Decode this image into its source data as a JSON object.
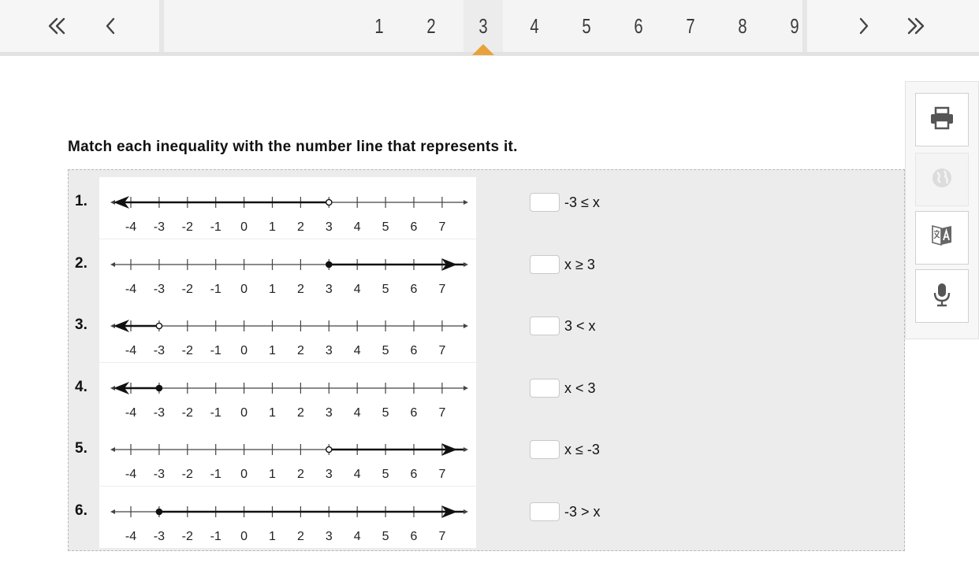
{
  "nav": {
    "first_icon": "double-chevron-left-icon",
    "prev_icon": "chevron-left-icon",
    "next_icon": "chevron-right-icon",
    "last_icon": "double-chevron-right-icon",
    "pages": [
      "1",
      "2",
      "3",
      "4",
      "5",
      "6",
      "7",
      "8",
      "9"
    ],
    "current_page": "3",
    "accent_color": "#e8a23c"
  },
  "instruction": "Match each inequality with the number line that represents it.",
  "number_line": {
    "ticks": [
      -4,
      -3,
      -2,
      -1,
      0,
      1,
      2,
      3,
      4,
      5,
      6,
      7
    ],
    "tick_labels": [
      "-4",
      "-3",
      "-2",
      "-1",
      "0",
      "1",
      "2",
      "3",
      "4",
      "5",
      "6",
      "7"
    ]
  },
  "rows": [
    {
      "number": "1.",
      "graph": {
        "point": 3,
        "closed": false,
        "direction": "left"
      },
      "answer_label": "-3 ≤ x"
    },
    {
      "number": "2.",
      "graph": {
        "point": 3,
        "closed": true,
        "direction": "right"
      },
      "answer_label": "x ≥ 3"
    },
    {
      "number": "3.",
      "graph": {
        "point": -3,
        "closed": false,
        "direction": "left"
      },
      "answer_label": "3 < x"
    },
    {
      "number": "4.",
      "graph": {
        "point": -3,
        "closed": true,
        "direction": "left"
      },
      "answer_label": "x < 3"
    },
    {
      "number": "5.",
      "graph": {
        "point": 3,
        "closed": false,
        "direction": "right"
      },
      "answer_label": "x ≤ -3"
    },
    {
      "number": "6.",
      "graph": {
        "point": -3,
        "closed": true,
        "direction": "right"
      },
      "answer_label": "-3 > x"
    }
  ],
  "tools": [
    {
      "icon": "printer-icon",
      "enabled": true
    },
    {
      "icon": "globe-icon",
      "enabled": false
    },
    {
      "icon": "translate-icon",
      "enabled": true
    },
    {
      "icon": "microphone-icon",
      "enabled": true
    }
  ]
}
